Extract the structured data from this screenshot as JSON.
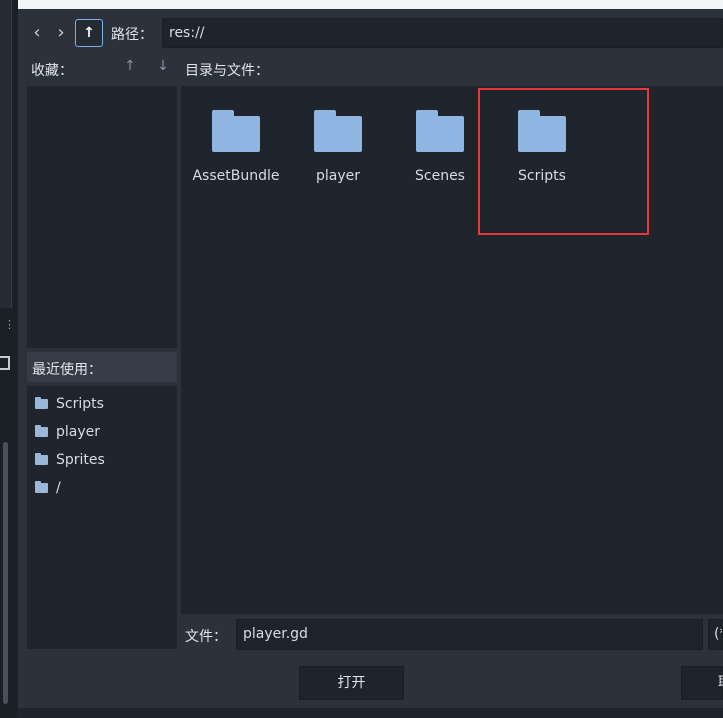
{
  "toolbar": {
    "back_icon": "chevron-left-icon",
    "forward_icon": "chevron-right-icon",
    "up_icon": "arrow-up-icon",
    "up_glyph": "↑",
    "path_label": "路径：",
    "path_value": "res://"
  },
  "favorites": {
    "label": "收藏：",
    "move_up_glyph": "↑",
    "move_down_glyph": "↓"
  },
  "recent": {
    "label": "最近使用：",
    "items": [
      {
        "label": "Scripts"
      },
      {
        "label": "player"
      },
      {
        "label": "Sprites"
      },
      {
        "label": "/"
      }
    ]
  },
  "files": {
    "label": "目录与文件：",
    "items": [
      {
        "label": "AssetBundle"
      },
      {
        "label": "player"
      },
      {
        "label": "Scenes"
      },
      {
        "label": "Scripts",
        "highlighted": true
      }
    ]
  },
  "file_field": {
    "label": "文件：",
    "value": "player.gd",
    "filter_value": "(*"
  },
  "buttons": {
    "open": "打开",
    "cancel": "取"
  },
  "colors": {
    "highlight": "#e53838",
    "folder": "#8fb6e3",
    "accent": "#7fb0e6"
  }
}
